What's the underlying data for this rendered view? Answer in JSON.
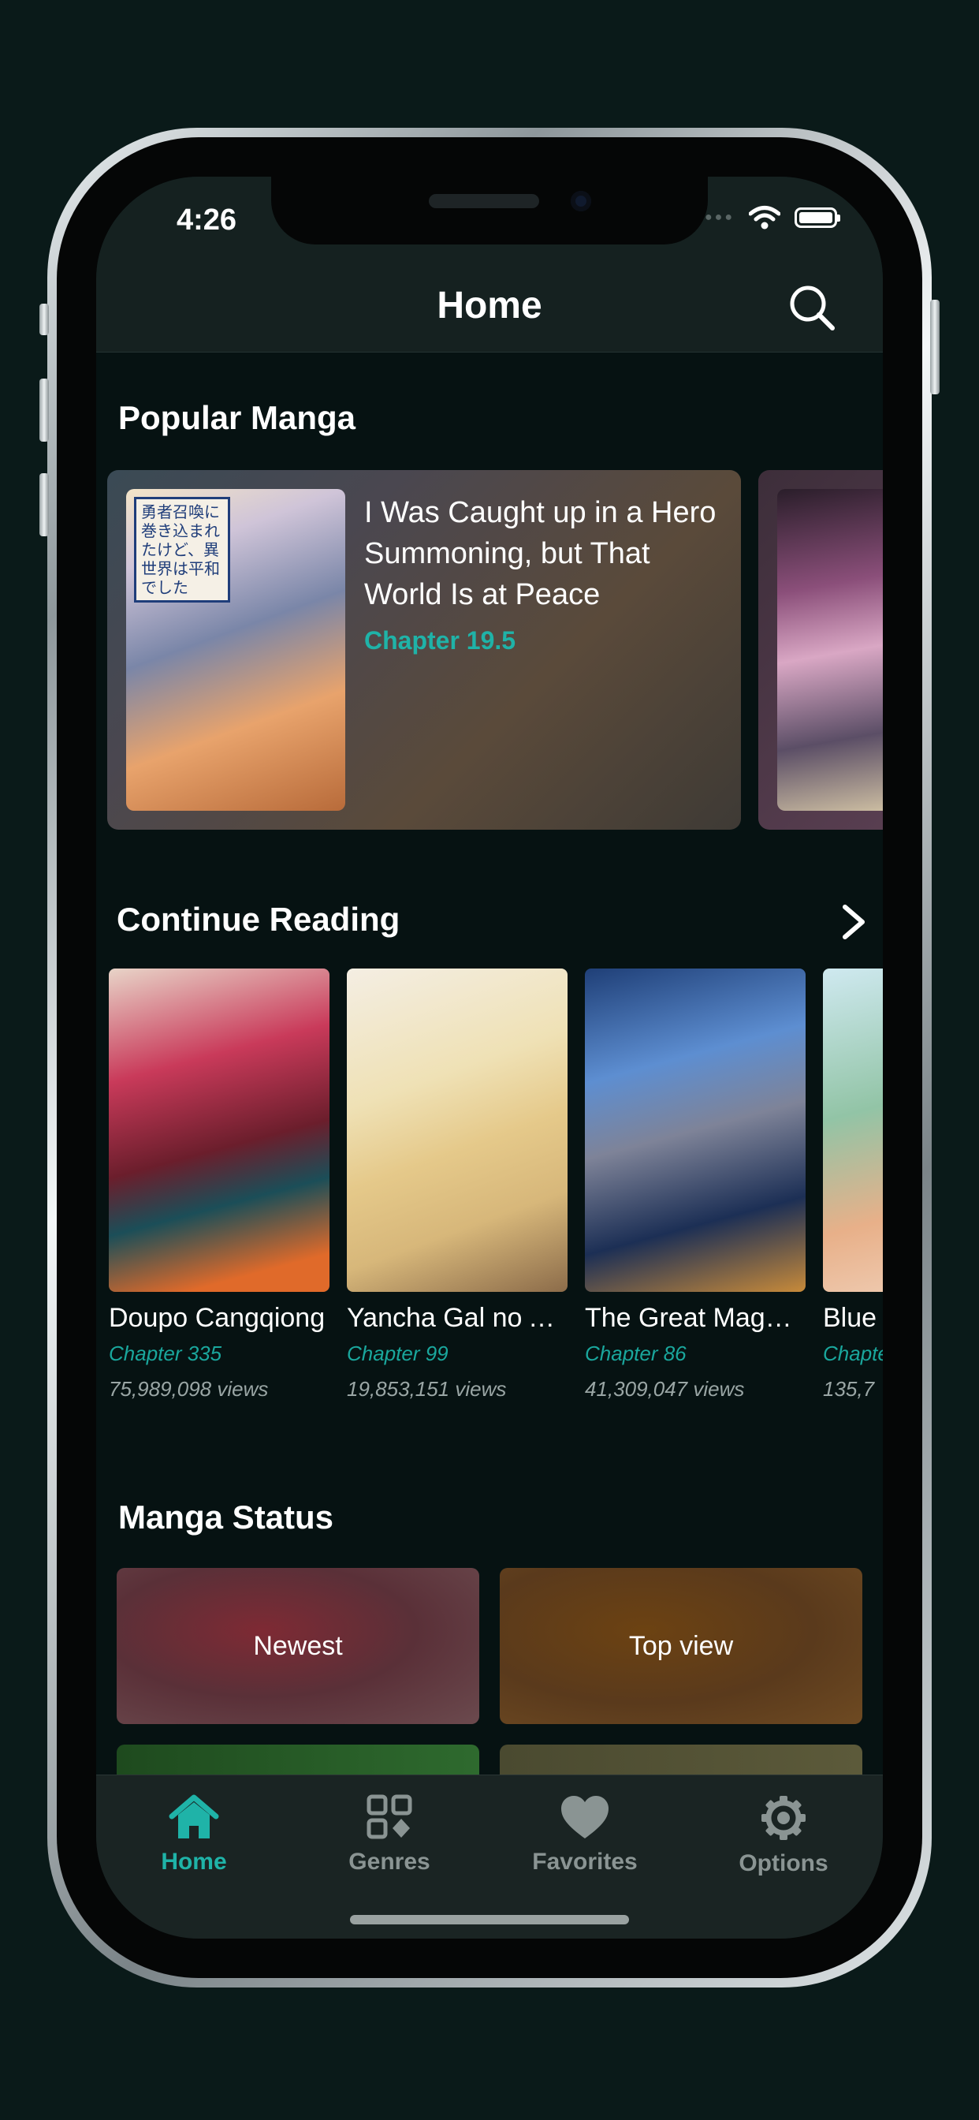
{
  "status_bar": {
    "time": "4:26"
  },
  "nav": {
    "title": "Home",
    "search_icon": "search-icon"
  },
  "popular": {
    "heading": "Popular Manga",
    "featured": {
      "title": "I Was Caught up in a Hero Summoning, but That World Is at Peace",
      "chapter": "Chapter 19.5"
    }
  },
  "continue_reading": {
    "heading": "Continue Reading",
    "items": [
      {
        "title": "Doupo Cangqiong",
        "chapter": "Chapter 335",
        "views": "75,989,098 views"
      },
      {
        "title": "Yancha Gal no A…",
        "chapter": "Chapter 99",
        "views": "19,853,151 views"
      },
      {
        "title": "The Great Mage…",
        "chapter": "Chapter 86",
        "views": "41,309,047 views"
      },
      {
        "title": "Blue",
        "chapter": "Chapte",
        "views": "135,7"
      }
    ]
  },
  "manga_status": {
    "heading": "Manga Status",
    "tiles": [
      "Newest",
      "Top view"
    ]
  },
  "tabs": [
    {
      "label": "Home",
      "icon": "home-icon",
      "active": true
    },
    {
      "label": "Genres",
      "icon": "grid-icon",
      "active": false
    },
    {
      "label": "Favorites",
      "icon": "heart-icon",
      "active": false
    },
    {
      "label": "Options",
      "icon": "gear-icon",
      "active": false
    }
  ],
  "colors": {
    "accent": "#1fb3a8",
    "background": "#061212",
    "inactive": "#8a9493"
  }
}
